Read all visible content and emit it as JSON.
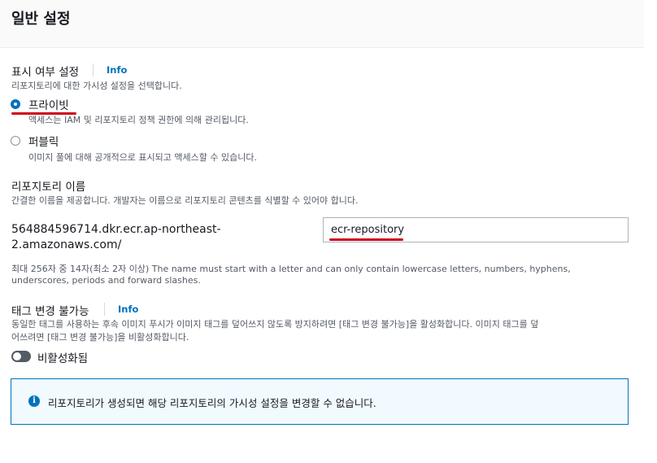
{
  "header": {
    "title": "일반 설정"
  },
  "visibility": {
    "label": "표시 여부 설정",
    "info": "Info",
    "description": "리포지토리에 대한 가시성 설정을 선택합니다.",
    "options": [
      {
        "label": "프라이빗",
        "description": "액세스는 IAM 및 리포지토리 정책 권한에 의해 관리됩니다.",
        "selected": true
      },
      {
        "label": "퍼블릭",
        "description": "이미지 풀에 대해 공개적으로 표시되고 액세스할 수 있습니다.",
        "selected": false
      }
    ]
  },
  "repository_name": {
    "label": "리포지토리 이름",
    "description": "간결한 이름을 제공합니다. 개발자는 이름으로 리포지토리 콘텐츠를 식별할 수 있어야 합니다.",
    "uri_prefix_line1": "564884596714.dkr.ecr.ap-northeast-",
    "uri_prefix_line2": "2.amazonaws.com/",
    "value": "ecr-repository",
    "constraint_line1": "최대 256자 중 14자(최소 2자 이상) The name must start with a letter and can only contain lowercase letters, numbers, hyphens,",
    "constraint_line2": "underscores, periods and forward slashes."
  },
  "tag_immutability": {
    "label": "태그 변경 불가능",
    "info": "Info",
    "description_line1": "동일한 태그를 사용하는 후속 이미지 푸시가 이미지 태그를 덮어쓰지 않도록 방지하려면 [태그 변경 불가능]을 활성화합니다. 이미지 태그를 덮",
    "description_line2": "어쓰려면 [태그 변경 불가능]을 비활성화합니다.",
    "toggle_label": "비활성화됨",
    "enabled": false
  },
  "alert": {
    "icon": "info-icon",
    "symbol": "i",
    "text": "리포지토리가 생성되면 해당 리포지토리의 가시성 설정을 변경할 수 없습니다."
  },
  "colors": {
    "accent": "#0073bb",
    "annotation": "#d0021b"
  }
}
